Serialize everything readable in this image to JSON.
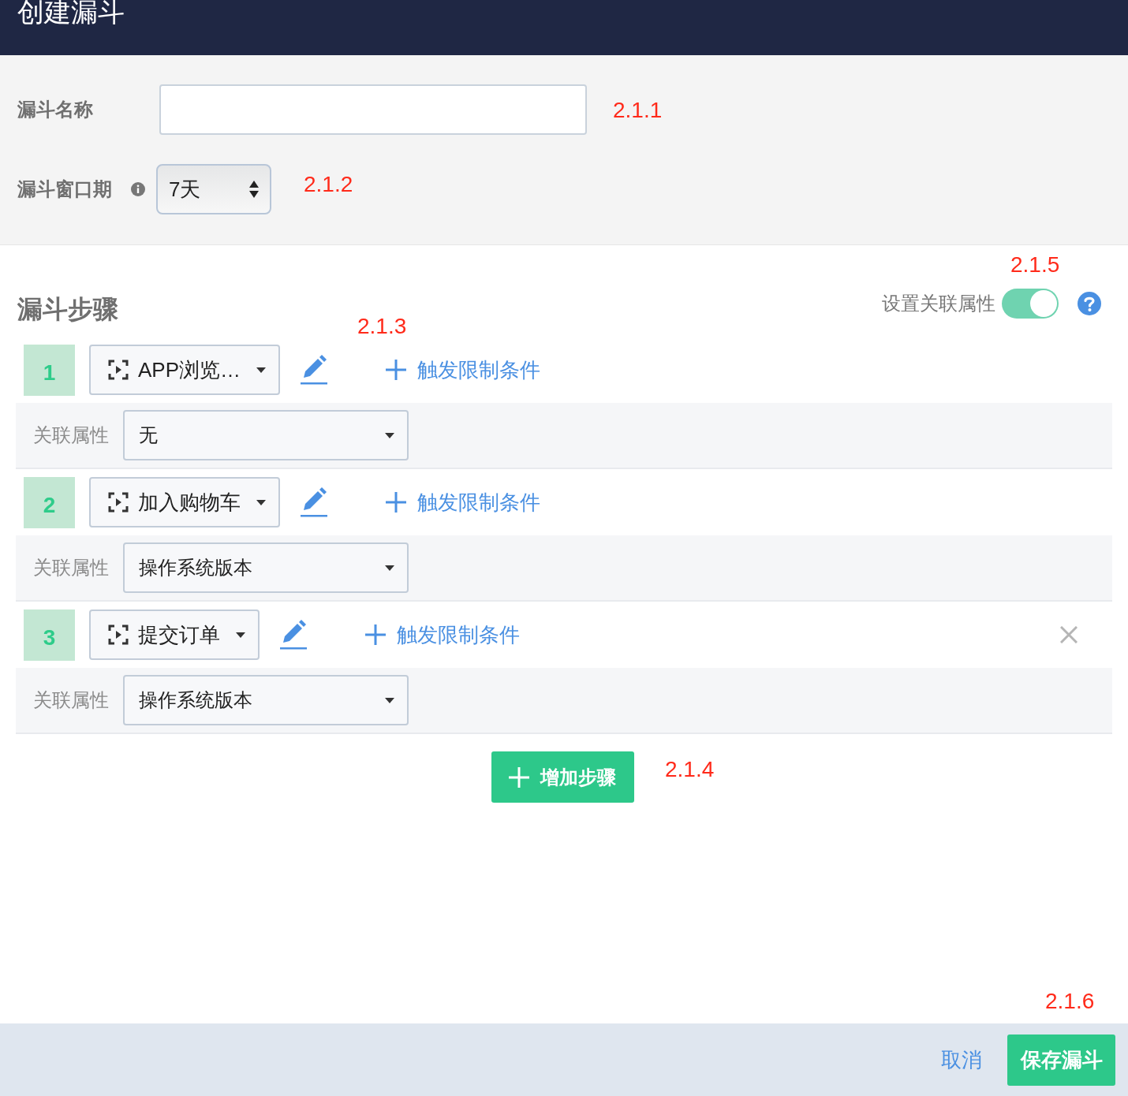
{
  "header": {
    "title": "创建漏斗"
  },
  "name_field": {
    "label": "漏斗名称",
    "annotation": "2.1.1"
  },
  "window_field": {
    "label": "漏斗窗口期",
    "value": "7天",
    "annotation": "2.1.2"
  },
  "steps_section": {
    "title": "漏斗步骤",
    "toggle_label": "设置关联属性",
    "toggle_on": true,
    "annotation": "2.1.5",
    "trigger_annotation": "2.1.3"
  },
  "steps": [
    {
      "number": "1",
      "event": "APP浏览…",
      "trigger_label": "触发限制条件",
      "attr_label": "关联属性",
      "attr_value": "无",
      "removable": false
    },
    {
      "number": "2",
      "event": "加入购物车",
      "trigger_label": "触发限制条件",
      "attr_label": "关联属性",
      "attr_value": "操作系统版本",
      "removable": false
    },
    {
      "number": "3",
      "event": "提交订单",
      "trigger_label": "触发限制条件",
      "attr_label": "关联属性",
      "attr_value": "操作系统版本",
      "removable": true
    }
  ],
  "add_step": {
    "label": "增加步骤",
    "annotation": "2.1.4"
  },
  "footer": {
    "cancel": "取消",
    "save": "保存漏斗",
    "annotation": "2.1.6"
  }
}
